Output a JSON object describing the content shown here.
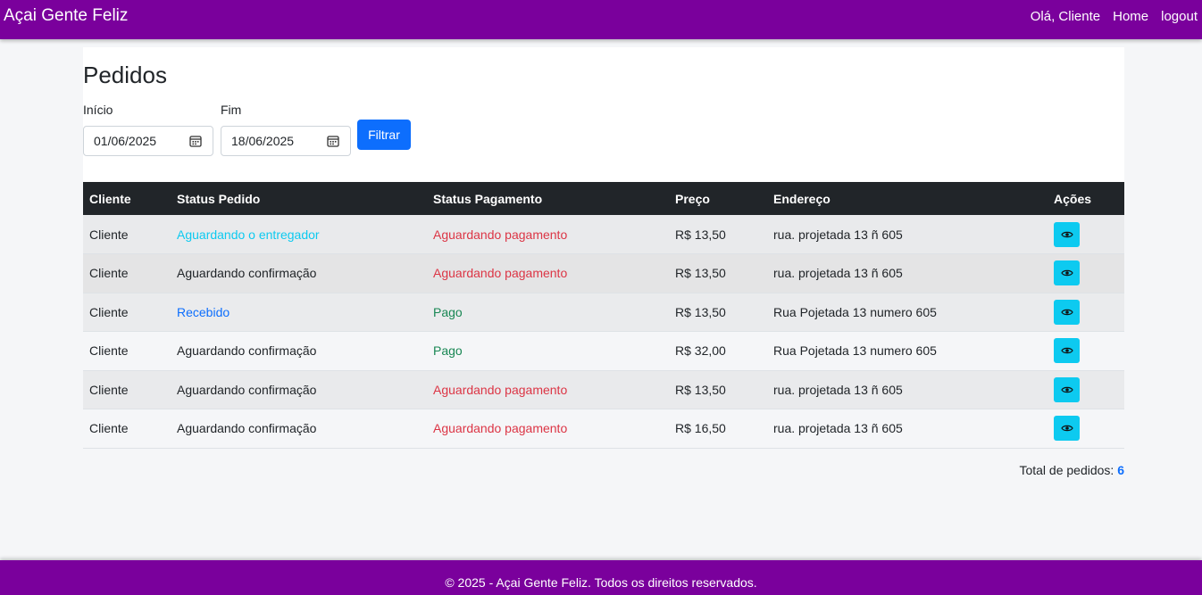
{
  "navbar": {
    "brand": "Açai Gente Feliz",
    "greeting": "Olá, Cliente",
    "home": "Home",
    "logout": "logout"
  },
  "page": {
    "title": "Pedidos"
  },
  "filters": {
    "start_label": "Início",
    "start_value": "01/06/2025",
    "end_label": "Fim",
    "end_value": "18/06/2025",
    "button": "Filtrar"
  },
  "table": {
    "columns": [
      "Cliente",
      "Status Pedido",
      "Status Pagamento",
      "Preço",
      "Endereço",
      "Ações"
    ],
    "rows": [
      {
        "cliente": "Cliente",
        "status_pedido": "Aguardando o entregador",
        "status_pagamento": "Aguardando pagamento",
        "preco": "R$ 13,50",
        "endereco": "rua. projetada 13 ñ 605"
      },
      {
        "cliente": "Cliente",
        "status_pedido": "Aguardando confirmação",
        "status_pagamento": "Aguardando pagamento",
        "preco": "R$ 13,50",
        "endereco": "rua. projetada 13 ñ 605"
      },
      {
        "cliente": "Cliente",
        "status_pedido": "Recebido",
        "status_pagamento": "Pago",
        "preco": "R$ 13,50",
        "endereco": "Rua Pojetada 13 numero 605"
      },
      {
        "cliente": "Cliente",
        "status_pedido": "Aguardando confirmação",
        "status_pagamento": "Pago",
        "preco": "R$ 32,00",
        "endereco": "Rua Pojetada 13 numero 605"
      },
      {
        "cliente": "Cliente",
        "status_pedido": "Aguardando confirmação",
        "status_pagamento": "Aguardando pagamento",
        "preco": "R$ 13,50",
        "endereco": "rua. projetada 13 ñ 605"
      },
      {
        "cliente": "Cliente",
        "status_pedido": "Aguardando confirmação",
        "status_pagamento": "Aguardando pagamento",
        "preco": "R$ 16,50",
        "endereco": "rua. projetada 13 ñ 605"
      }
    ],
    "action_icon": "eye-icon"
  },
  "summary": {
    "label": "Total de pedidos:",
    "count": "6"
  },
  "footer": {
    "text": "© 2025 - Açai Gente Feliz. Todos os direitos reservados."
  },
  "colors": {
    "brand": "#7a009c",
    "primary": "#0d6efd",
    "info": "#0dcaf0",
    "danger": "#dc3545",
    "success": "#198754",
    "table_header": "#212529"
  }
}
